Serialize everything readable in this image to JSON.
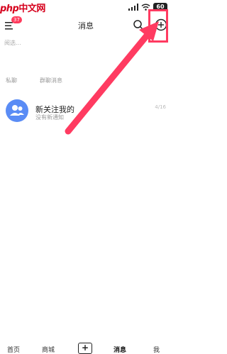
{
  "status_bar": {
    "watermark_php": "php",
    "watermark_text": "中文网",
    "battery": "60"
  },
  "header": {
    "title": "消息",
    "badge_count": "37"
  },
  "search": {
    "placeholder": "阅选..."
  },
  "shortcuts": [
    {
      "label": "私聊"
    },
    {
      "label": "群聊消息"
    }
  ],
  "conversations": [
    {
      "title": "新关注我的",
      "subtitle": "没有新通知",
      "time": "4/16"
    }
  ],
  "bottom_nav": {
    "items": [
      {
        "label": "首页"
      },
      {
        "label": "商城"
      },
      {
        "label": "+"
      },
      {
        "label": "消息"
      },
      {
        "label": "我"
      }
    ]
  },
  "colors": {
    "accent": "#ff3b61",
    "avatar": "#5a8cf5",
    "badge": "#ff3b5c"
  }
}
